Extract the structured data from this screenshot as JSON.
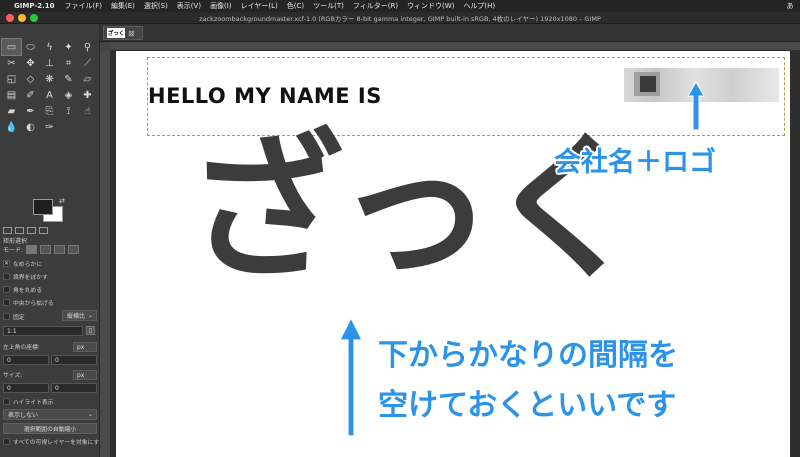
{
  "menubar": {
    "app_name": "GIMP-2.10",
    "items": [
      "ファイル(F)",
      "編集(E)",
      "選択(S)",
      "表示(V)",
      "画像(I)",
      "レイヤー(L)",
      "色(C)",
      "ツール(T)",
      "フィルター(R)",
      "ウィンドウ(W)",
      "ヘルプ(H)"
    ],
    "input_indicator": "あ"
  },
  "window": {
    "title": "zackzoombackgroundmaster.xcf-1.0 (RGBカラー 8-bit gamma integer, GIMP built-in sRGB, 4枚のレイヤー) 1920x1080 – GIMP"
  },
  "toolbox": {
    "tool_icons": [
      "rect-select",
      "ellipse-select",
      "free-select",
      "fuzzy-select",
      "scissors",
      "move",
      "align",
      "crop",
      "unified-transform",
      "cage",
      "warp",
      "paths",
      "text",
      "fill",
      "gradient",
      "paintbrush",
      "eraser",
      "airbrush",
      "ink",
      "clone",
      "heal",
      "perspective-clone",
      "blur",
      "smudge",
      "dodge",
      "color-picker",
      "measure",
      "zoom"
    ],
    "tool_options": {
      "title": "矩形選択",
      "mode_label": "モード:",
      "antialias_label": "なめらかに",
      "feather_label": "境界をぼかす",
      "rounded_label": "角を丸める",
      "expand_center_label": "中央から拡げる",
      "fixed_label": "固定",
      "fixed_value": "縦横比",
      "ratio_value": "1:1",
      "position_label": "左上角の座標:",
      "position_unit": "px",
      "position_x": "0",
      "position_y": "0",
      "size_label": "サイズ:",
      "size_unit": "px",
      "size_w": "0",
      "size_h": "0",
      "highlight_label": "ハイライト表示",
      "guides_value": "表示しない",
      "autoshrink_label": "選択範囲の自動縮小",
      "all_layers_label": "すべての可視レイヤーを対象にする"
    }
  },
  "image_tab": {
    "thumb_text": "ざっく"
  },
  "canvas": {
    "hello_text": "HELLO MY NAME IS",
    "big_text": "ざっく",
    "annotations": {
      "company": "会社名＋ロゴ",
      "line1": "下からかなりの間隔を",
      "line2": "空けておくといいです"
    },
    "accent_color": "#2b93ea"
  }
}
